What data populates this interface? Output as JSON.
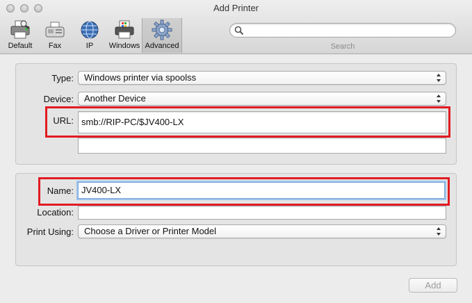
{
  "window": {
    "title": "Add Printer"
  },
  "toolbar": {
    "items": [
      {
        "label": "Default",
        "icon": "printer-icon"
      },
      {
        "label": "Fax",
        "icon": "fax-icon"
      },
      {
        "label": "IP",
        "icon": "globe-icon"
      },
      {
        "label": "Windows",
        "icon": "windows-printer-icon"
      },
      {
        "label": "Advanced",
        "icon": "gear-icon",
        "selected": true
      }
    ]
  },
  "search": {
    "value": "",
    "placeholder": "",
    "label": "Search"
  },
  "form": {
    "type": {
      "label": "Type:",
      "value": "Windows printer via spoolss"
    },
    "device": {
      "label": "Device:",
      "value": "Another Device"
    },
    "url": {
      "label": "URL:",
      "value": "smb://RIP-PC/$JV400-LX"
    },
    "extra": {
      "value": ""
    },
    "name": {
      "label": "Name:",
      "value": "JV400-LX"
    },
    "location": {
      "label": "Location:",
      "value": ""
    },
    "print_using": {
      "label": "Print Using:",
      "value": "Choose a Driver or Printer Model"
    }
  },
  "buttons": {
    "add": "Add"
  },
  "colors": {
    "highlight": "#e11b22",
    "window_bg": "#ececec"
  }
}
